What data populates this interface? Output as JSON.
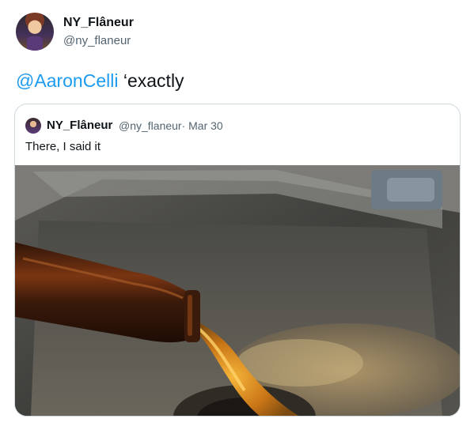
{
  "tweet": {
    "display_name": "NY_Flâneur",
    "handle": "@ny_flaneur",
    "mention": "@AaronCelli",
    "text": " ‘exactly"
  },
  "quoted_tweet": {
    "display_name": "NY_Flâneur",
    "handle_date": "@ny_flaneur· Mar 30",
    "text": "There, I said it"
  },
  "colors": {
    "link": "#1d9bf0",
    "secondary_text": "#536471",
    "border": "#cfd9de"
  }
}
